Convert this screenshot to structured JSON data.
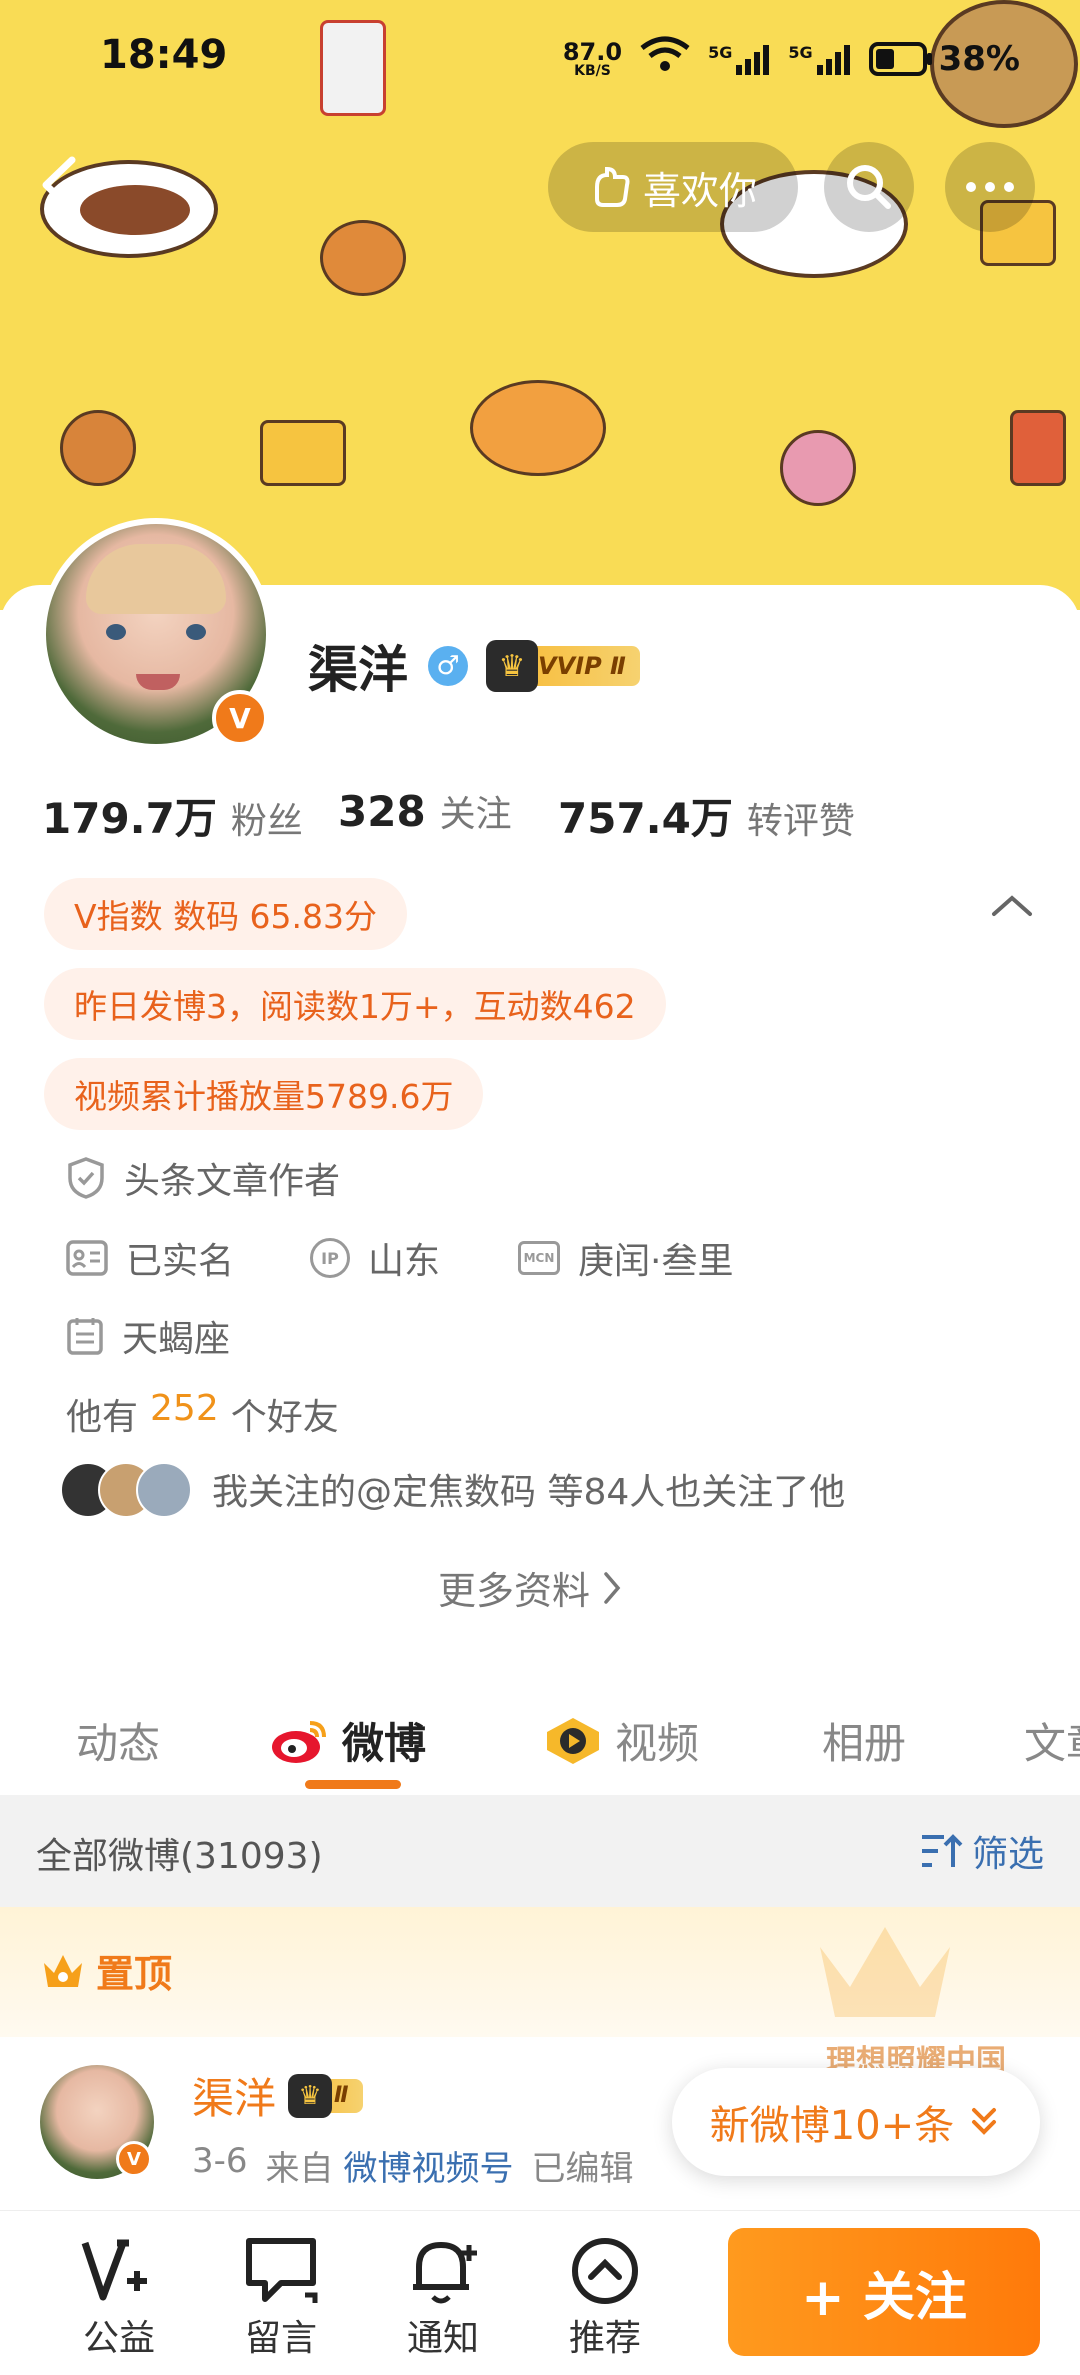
{
  "status_bar": {
    "time": "18:49",
    "net_speed": "87.0",
    "net_unit": "KB/S",
    "signal1": "5G",
    "signal2": "5G",
    "battery": "38%"
  },
  "header": {
    "like_label": "喜欢你",
    "back_icon": "back-arrow-icon",
    "search_icon": "search-icon",
    "more_icon": "more-icon"
  },
  "profile": {
    "name": "渠洋",
    "gender_symbol": "♂",
    "vip_label": "VVIP Ⅱ",
    "verified_mark": "V",
    "stats": [
      {
        "value": "179.7万",
        "label": "粉丝"
      },
      {
        "value": "328",
        "label": "关注"
      },
      {
        "value": "757.4万",
        "label": "转评赞"
      }
    ],
    "tags": [
      "V指数 数码 65.83分",
      "昨日发博3，阅读数1万+，互动数462",
      "视频累计播放量5789.6万"
    ],
    "info": {
      "author_badge": "头条文章作者",
      "realname": "已实名",
      "ip_icon_text": "IP",
      "ip_location": "山东",
      "mcn_icon_text": "MCN",
      "mcn": "庚闰·叁里",
      "zodiac": "天蝎座",
      "friends_prefix": "他有",
      "friends_count": "252",
      "friends_suffix": "个好友",
      "mutual": "我关注的@定焦数码 等84人也关注了他",
      "more": "更多资料"
    }
  },
  "tabs": [
    "动态",
    "微博",
    "视频",
    "相册",
    "文章"
  ],
  "feed": {
    "all_posts": "全部微博(31093)",
    "filter": "筛选",
    "pinned": "置顶",
    "pinned_banner": "理想照耀中国",
    "post_author": "渠洋",
    "post_date": "3-6",
    "post_from_prefix": "来自",
    "post_source": "微博视频号",
    "post_edited": "已编辑",
    "new_posts": "新微博10+条"
  },
  "bottom_nav": [
    {
      "label": "公益",
      "icon": "charity-icon"
    },
    {
      "label": "留言",
      "icon": "message-icon"
    },
    {
      "label": "通知",
      "icon": "bell-icon"
    },
    {
      "label": "推荐",
      "icon": "recommend-icon"
    }
  ],
  "follow_button": "+ 关注",
  "colors": {
    "accent": "#f07a1a",
    "banner": "#f9dc55",
    "tag_bg": "#fff1ea"
  }
}
